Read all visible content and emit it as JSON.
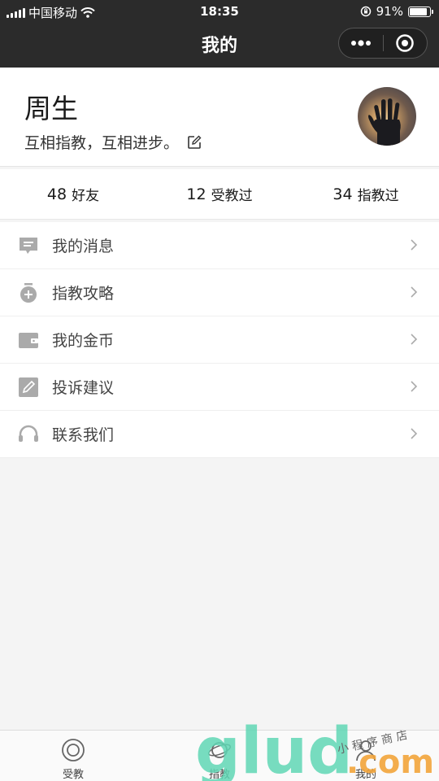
{
  "status_bar": {
    "carrier": "中国移动",
    "time": "18:35",
    "battery": "91%",
    "battery_level": 0.91
  },
  "nav": {
    "title": "我的"
  },
  "profile": {
    "name": "周生",
    "motto": "互相指教，互相进步。"
  },
  "stats": [
    {
      "count": "48",
      "label": "好友"
    },
    {
      "count": "12",
      "label": "受教过"
    },
    {
      "count": "34",
      "label": "指教过"
    }
  ],
  "menu": [
    {
      "label": "我的消息",
      "icon": "message-icon"
    },
    {
      "label": "指教攻略",
      "icon": "timer-plus-icon"
    },
    {
      "label": "我的金币",
      "icon": "wallet-icon"
    },
    {
      "label": "投诉建议",
      "icon": "edit-icon"
    },
    {
      "label": "联系我们",
      "icon": "headset-icon"
    }
  ],
  "tabbar": [
    {
      "label": "受教",
      "icon": "circle-icon"
    },
    {
      "label": "指教",
      "icon": "planet-icon"
    },
    {
      "label": "我的",
      "icon": "user-icon"
    }
  ],
  "watermark": {
    "brand": "glud.com",
    "tagline": "小 程 序 商 店"
  }
}
